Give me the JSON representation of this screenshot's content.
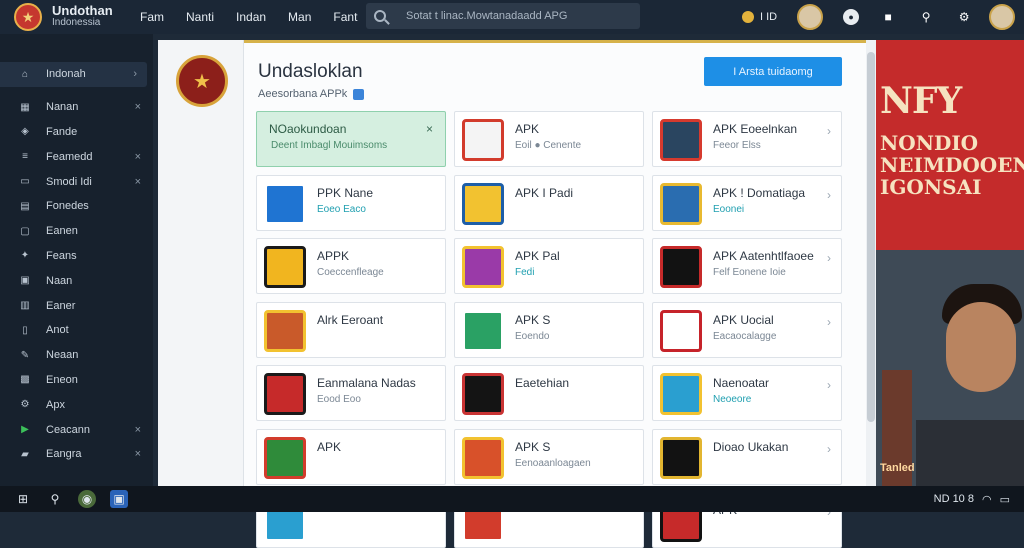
{
  "header": {
    "brand_title": "Undothan",
    "brand_sub": "Indonessia",
    "nav": [
      "Fam",
      "Nanti",
      "Indan",
      "Man",
      "Fant"
    ],
    "search_placeholder": "Sotat t linac.Mowtanadaadd APG",
    "coin_label": "I ID"
  },
  "sidebar": {
    "items": [
      {
        "label": "Indonah",
        "icon": "home-icon",
        "suffix": "chevron"
      },
      {
        "label": "Nanan",
        "icon": "grid-icon",
        "suffix": "close"
      },
      {
        "label": "Fande",
        "icon": "tag-icon",
        "suffix": "none"
      },
      {
        "label": "Feamedd",
        "icon": "list-icon",
        "suffix": "close"
      },
      {
        "label": "Smodi Idi",
        "icon": "folder-icon",
        "suffix": "close"
      },
      {
        "label": "Fonedes",
        "icon": "file-icon",
        "suffix": "none"
      },
      {
        "label": "Eanen",
        "icon": "doc-icon",
        "suffix": "none"
      },
      {
        "label": "Feans",
        "icon": "star-icon",
        "suffix": "none"
      },
      {
        "label": "Naan",
        "icon": "box-icon",
        "suffix": "none"
      },
      {
        "label": "Eaner",
        "icon": "chart-icon",
        "suffix": "none"
      },
      {
        "label": "Anot",
        "icon": "note-icon",
        "suffix": "none"
      },
      {
        "label": "Neaan",
        "icon": "wrench-icon",
        "suffix": "none"
      },
      {
        "label": "Eneon",
        "icon": "image-icon",
        "suffix": "none"
      },
      {
        "label": "Apx",
        "icon": "settings-icon",
        "suffix": "none"
      },
      {
        "label": "Ceacann",
        "icon": "play-icon",
        "suffix": "close"
      },
      {
        "label": "Eangra",
        "icon": "lock-icon",
        "suffix": "close"
      }
    ]
  },
  "main": {
    "title": "Undasloklan",
    "subtitle": "Aeesorbana APPk",
    "primary_button": "I Arsta tuidaomg",
    "cards": [
      {
        "title": "NOaokundoan",
        "sub": "Deent Imbagl Mouimsoms",
        "highlight": true,
        "color": "#ffffff",
        "accent": "#ffffff",
        "sub_style": "normal"
      },
      {
        "title": "APK",
        "sub": "Eoil ● Cenente",
        "highlight": false,
        "color": "#f4f4f4",
        "accent": "#d23b2c",
        "sub_style": "normal"
      },
      {
        "title": "APK Eoeelnkan",
        "sub": "Feeor Elss",
        "highlight": false,
        "color": "#2a4560",
        "accent": "#d63a2e",
        "sub_style": "normal"
      },
      {
        "title": "PPK Nane",
        "sub": "Eoeo Eaco",
        "highlight": false,
        "color": "#1f74d2",
        "accent": "#ffffff",
        "sub_style": "teal"
      },
      {
        "title": "APK I Padi",
        "sub": "",
        "highlight": false,
        "color": "#f2c230",
        "accent": "#1d5ea8",
        "sub_style": "normal"
      },
      {
        "title": "APK ! Domatiaga",
        "sub": "Eoonei",
        "highlight": false,
        "color": "#2a6db0",
        "accent": "#e8b930",
        "sub_style": "teal"
      },
      {
        "title": "APPK",
        "sub": "Coeccenfleage",
        "highlight": false,
        "color": "#f1b51f",
        "accent": "#1a1a1a",
        "sub_style": "normal"
      },
      {
        "title": "APK Pal",
        "sub": "Fedi",
        "highlight": false,
        "color": "#9a3aa8",
        "accent": "#f2c230",
        "sub_style": "teal"
      },
      {
        "title": "APK Aatenhtlfaoee",
        "sub": "Felf Eonene Ioie",
        "highlight": false,
        "color": "#121212",
        "accent": "#c62a2a",
        "sub_style": "normal"
      },
      {
        "title": "Alrk Eeroant",
        "sub": "",
        "highlight": false,
        "color": "#c95a2a",
        "accent": "#f2c230",
        "sub_style": "normal"
      },
      {
        "title": "APK S",
        "sub": "Eoendo",
        "highlight": false,
        "color": "#2aa164",
        "accent": "#ffffff",
        "sub_style": "normal"
      },
      {
        "title": "APK Uocial",
        "sub": "Eacaocalagge",
        "highlight": false,
        "color": "#ffffff",
        "accent": "#c6232a",
        "sub_style": "normal"
      },
      {
        "title": "Eanmalana Nadas",
        "sub": "Eood Eoo",
        "highlight": false,
        "color": "#c62a2a",
        "accent": "#1a1a1a",
        "sub_style": "normal"
      },
      {
        "title": "Eaetehian",
        "sub": "",
        "highlight": false,
        "color": "#141414",
        "accent": "#c93434",
        "sub_style": "normal"
      },
      {
        "title": "Naenoatar",
        "sub": "Neoeore",
        "highlight": false,
        "color": "#2a9fd0",
        "accent": "#f2c230",
        "sub_style": "teal"
      },
      {
        "title": "APK",
        "sub": "",
        "highlight": false,
        "color": "#2f8b3a",
        "accent": "#d23c2c",
        "sub_style": "normal"
      },
      {
        "title": "APK S",
        "sub": "Eenoaanloagaen",
        "highlight": false,
        "color": "#d8512a",
        "accent": "#f2c230",
        "sub_style": "normal"
      },
      {
        "title": "Dioao Ukakan",
        "sub": "",
        "highlight": false,
        "color": "#121212",
        "accent": "#e2b530",
        "sub_style": "normal"
      },
      {
        "title": "",
        "sub": "",
        "highlight": false,
        "color": "#2a9fd0",
        "accent": "#ffffff",
        "sub_style": "normal"
      },
      {
        "title": "",
        "sub": "",
        "highlight": false,
        "color": "#d23c2c",
        "accent": "#ffffff",
        "sub_style": "normal"
      },
      {
        "title": "APK",
        "sub": "",
        "highlight": false,
        "color": "#c62a2a",
        "accent": "#121212",
        "sub_style": "normal"
      }
    ]
  },
  "ad": {
    "line1": "NFY",
    "line2": "NONDIO NEIMDOOEN IGONSAI",
    "sign": "Tanled"
  },
  "taskbar": {
    "right_text": "ND 10 8"
  }
}
